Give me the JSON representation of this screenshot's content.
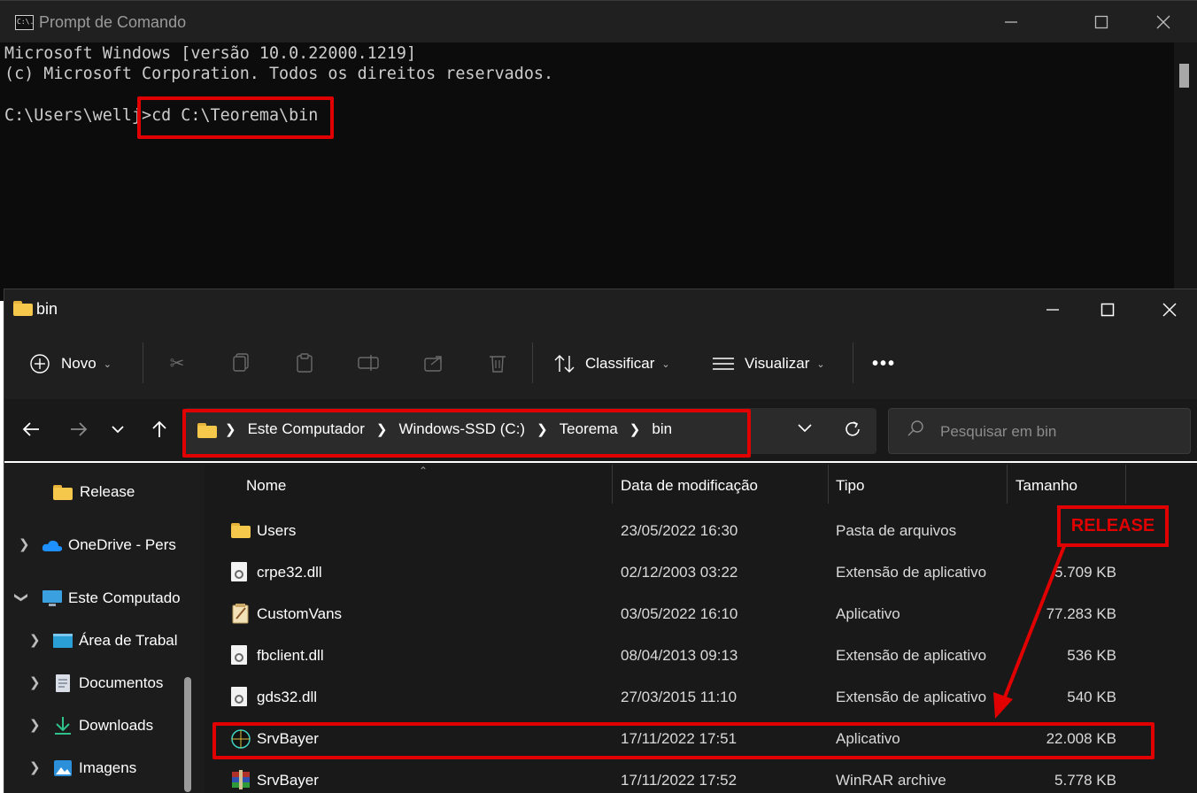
{
  "cmd": {
    "title": "Prompt de Comando",
    "icon_text": "C:\\.",
    "lines": [
      "Microsoft Windows [versão 10.0.22000.1219]",
      "(c) Microsoft Corporation. Todos os direitos reservados."
    ],
    "prompt": "C:\\Users\\wellj>",
    "command": "cd C:\\Teorema\\bin"
  },
  "explorer": {
    "title": "bin",
    "toolbar": {
      "new_label": "Novo",
      "sort_label": "Classificar",
      "view_label": "Visualizar"
    },
    "breadcrumb": [
      "Este Computador",
      "Windows-SSD (C:)",
      "Teorema",
      "bin"
    ],
    "search_placeholder": "Pesquisar em bin",
    "sidebar": [
      {
        "label": "Release",
        "icon": "folder-icon"
      },
      {
        "label": "OneDrive - Pers",
        "icon": "onedrive-icon"
      },
      {
        "label": "Este Computado",
        "icon": "computer-icon"
      },
      {
        "label": "Área de Trabal",
        "icon": "desktop-icon"
      },
      {
        "label": "Documentos",
        "icon": "documents-icon"
      },
      {
        "label": "Downloads",
        "icon": "download-icon"
      },
      {
        "label": "Imagens",
        "icon": "images-icon"
      }
    ],
    "columns": [
      "Nome",
      "Data de modificação",
      "Tipo",
      "Tamanho"
    ],
    "files": [
      {
        "name": "Users",
        "date": "23/05/2022 16:30",
        "type": "Pasta de arquivos",
        "size": "",
        "icon": "folder-icon"
      },
      {
        "name": "crpe32.dll",
        "date": "02/12/2003 03:22",
        "type": "Extensão de aplicativo",
        "size": "5.709 KB",
        "icon": "dll-icon"
      },
      {
        "name": "CustomVans",
        "date": "03/05/2022 16:10",
        "type": "Aplicativo",
        "size": "77.283 KB",
        "icon": "app-icon"
      },
      {
        "name": "fbclient.dll",
        "date": "08/04/2013 09:13",
        "type": "Extensão de aplicativo",
        "size": "536 KB",
        "icon": "dll-icon"
      },
      {
        "name": "gds32.dll",
        "date": "27/03/2015 11:10",
        "type": "Extensão de aplicativo",
        "size": "540 KB",
        "icon": "dll-icon"
      },
      {
        "name": "SrvBayer",
        "date": "17/11/2022 17:51",
        "type": "Aplicativo",
        "size": "22.008 KB",
        "icon": "srvbayer-icon"
      },
      {
        "name": "SrvBayer",
        "date": "17/11/2022 17:52",
        "type": "WinRAR archive",
        "size": "5.778 KB",
        "icon": "winrar-icon"
      }
    ]
  },
  "annotation": {
    "release_label": "RELEASE",
    "color": "#e00000"
  }
}
